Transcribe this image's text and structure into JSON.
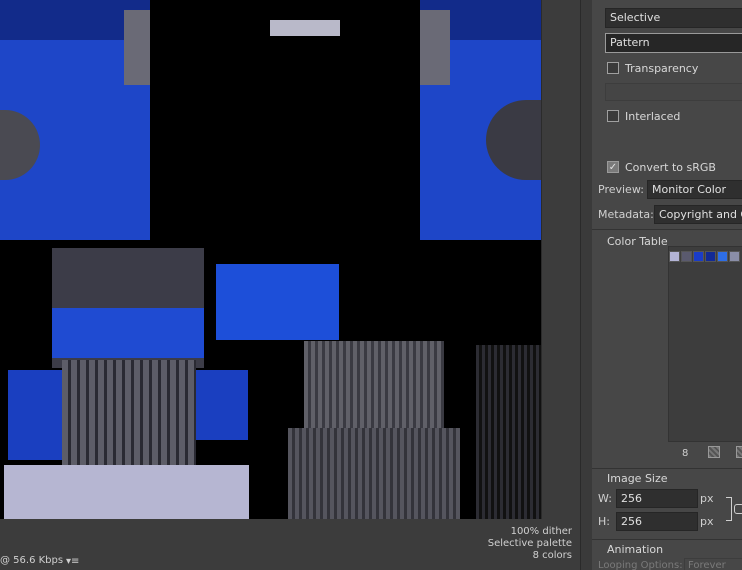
{
  "settings": {
    "palette_value": "Selective",
    "dither_value": "Pattern",
    "transparency_label": "Transparency",
    "transparency_checked": false,
    "interlaced_label": "Interlaced",
    "interlaced_checked": false,
    "convert_srgb_label": "Convert to sRGB",
    "convert_srgb_checked": true,
    "preview_label": "Preview:",
    "preview_value": "Monitor Color",
    "metadata_label": "Metadata:",
    "metadata_value": "Copyright and Co"
  },
  "color_table": {
    "title": "Color Table",
    "swatches": [
      "#b3b4d6",
      "#5a5a6e",
      "#1a3cc8",
      "#122a96",
      "#2e6ee6",
      "#8a8ea8"
    ],
    "count": "8"
  },
  "image_size": {
    "title": "Image Size",
    "w_label": "W:",
    "w_value": "256",
    "h_label": "H:",
    "h_value": "256",
    "unit": "px"
  },
  "animation": {
    "title": "Animation",
    "looping_label": "Looping Options:",
    "looping_value": "Forever"
  },
  "status": {
    "dither_info": "100% dither",
    "palette_info": "Selective palette",
    "colors_info": "8 colors",
    "speed": "@ 56.6 Kbps",
    "menu_glyph": "▾≡"
  }
}
